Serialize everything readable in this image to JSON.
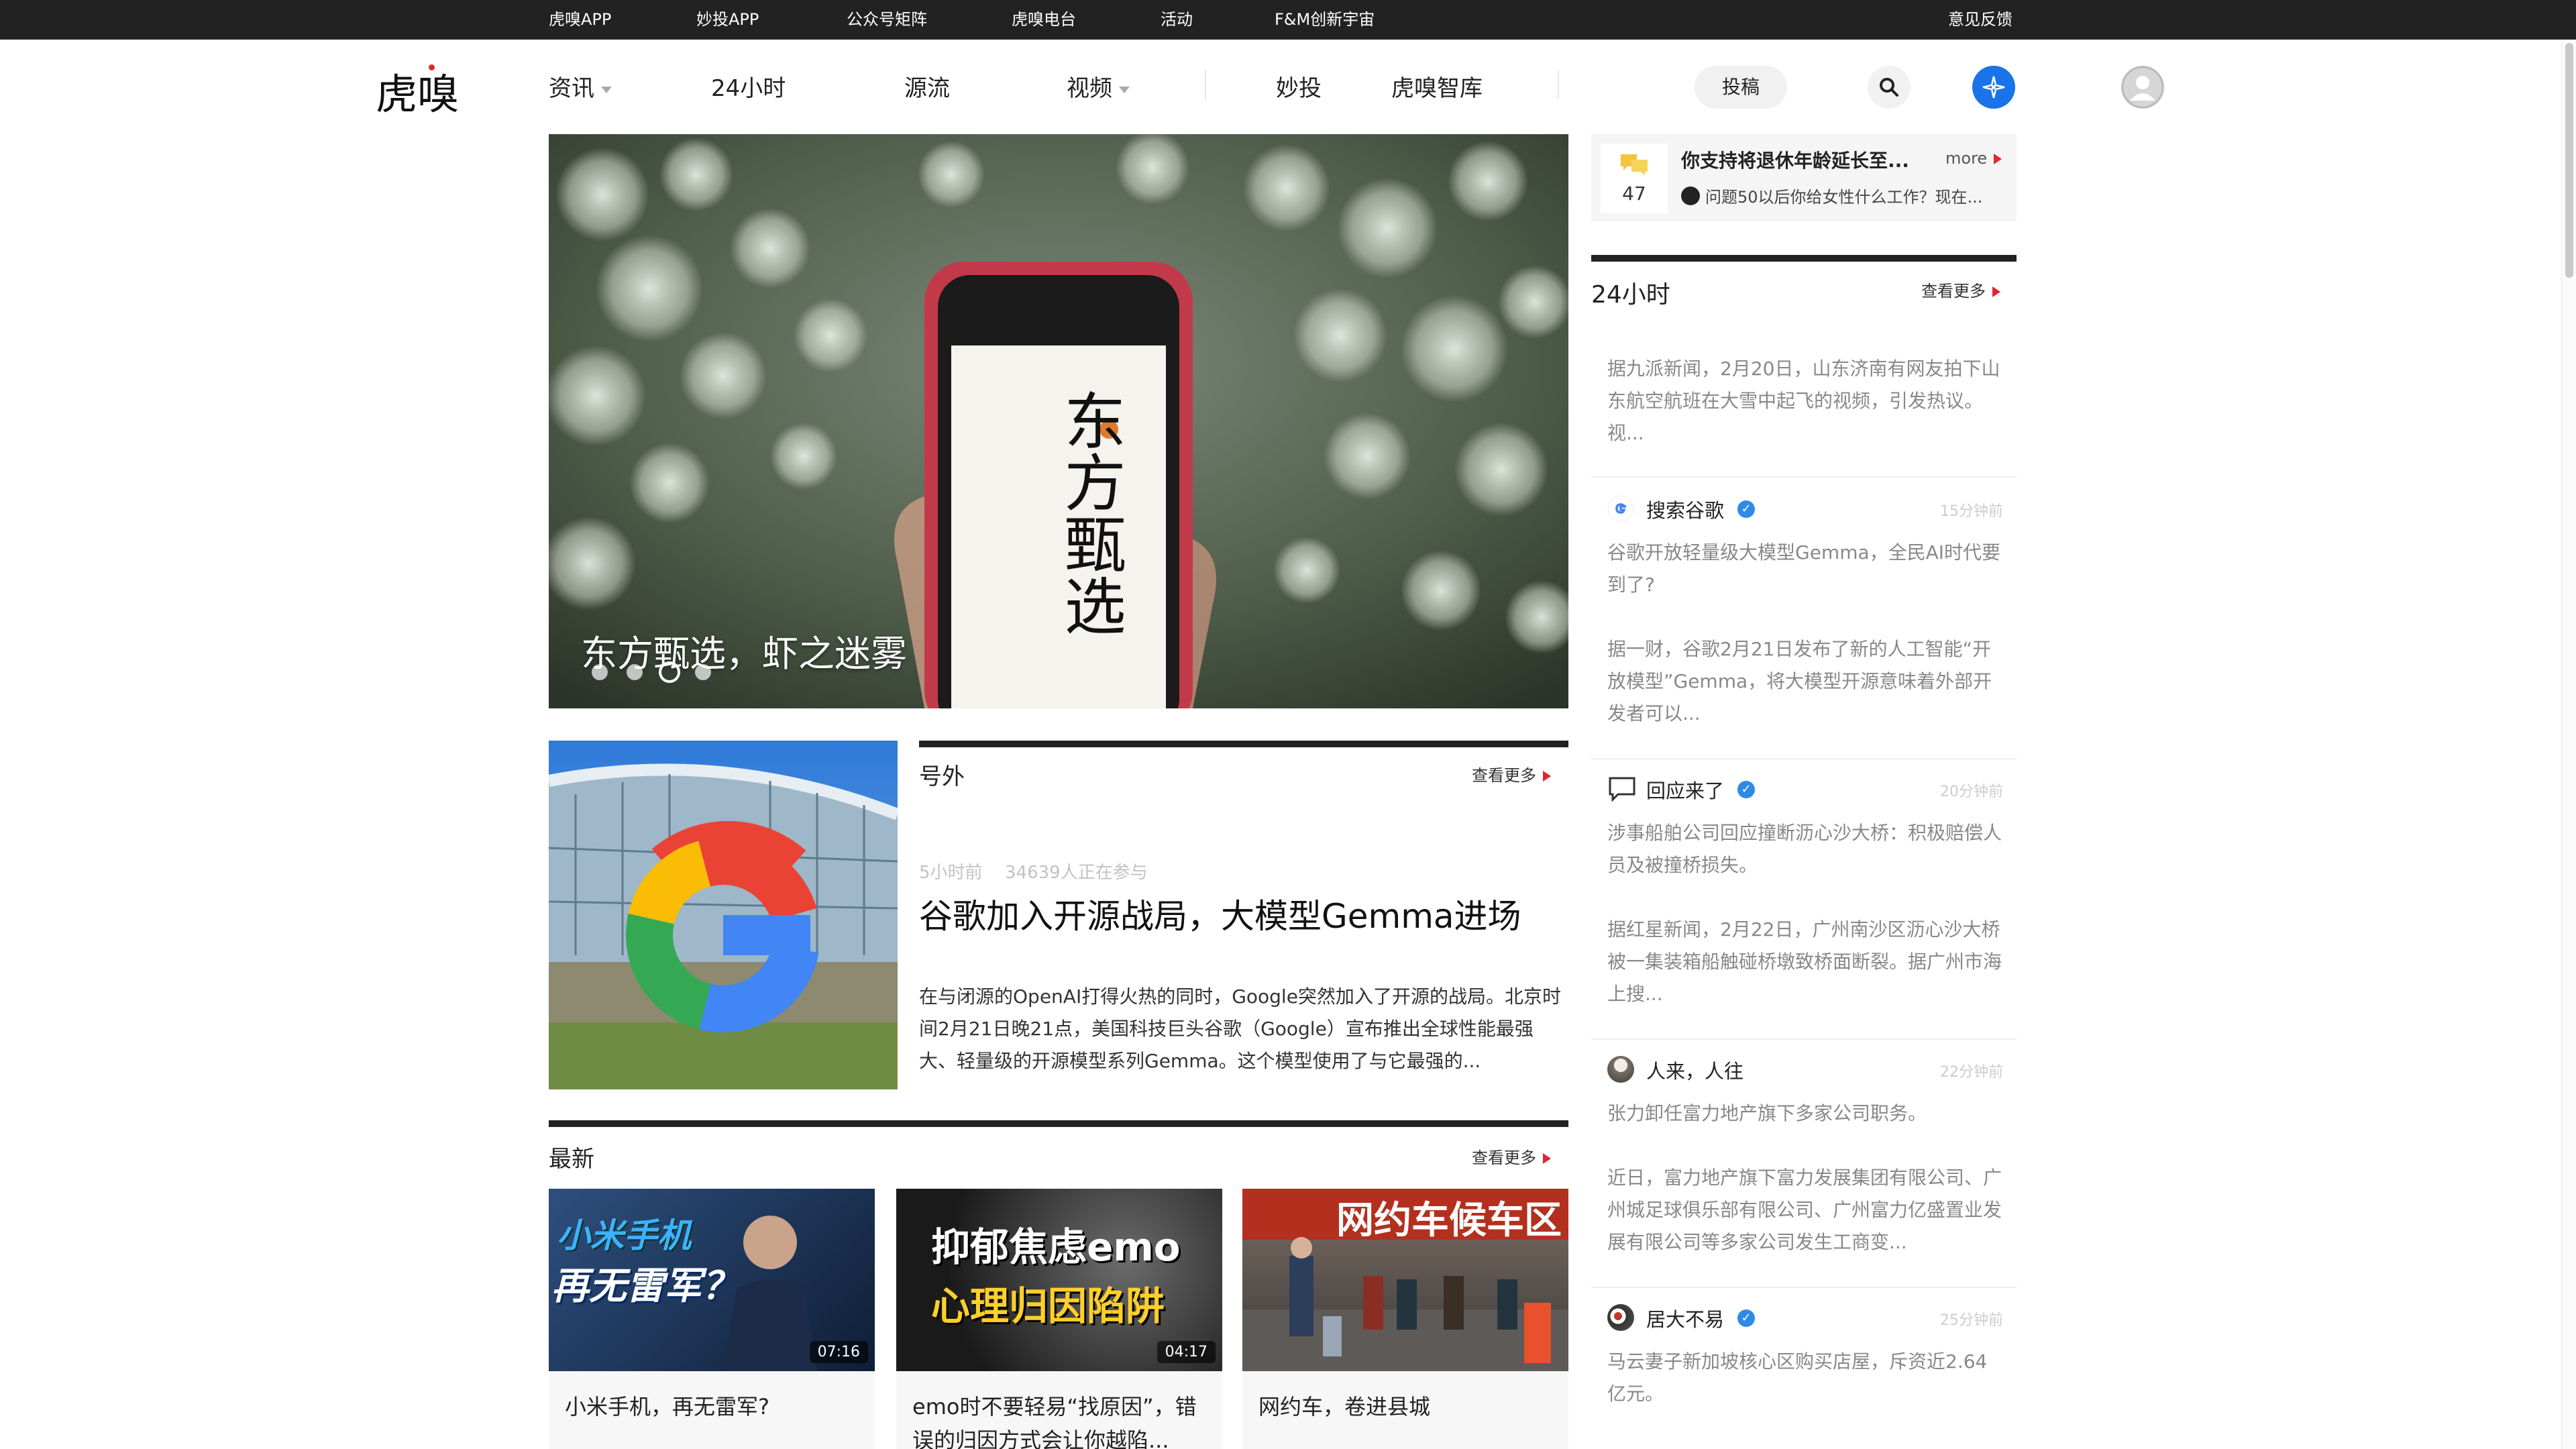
{
  "topbar": {
    "links": [
      "虎嗅APP",
      "妙投APP",
      "公众号矩阵",
      "虎嗅电台",
      "活动",
      "F&M创新宇宙"
    ],
    "feedback": "意见反馈"
  },
  "header": {
    "logo": "虎嗅",
    "nav": [
      "资讯",
      "24小时",
      "源流",
      "视频",
      "妙投",
      "虎嗅智库"
    ],
    "submit_label": "投稿"
  },
  "hero": {
    "title": "东方甄选，虾之迷雾",
    "phone_text": "东方甄选",
    "slides": 4,
    "active_slide": 3
  },
  "extra": {
    "section_title": "号外",
    "more": "查看更多",
    "time": "5小时前",
    "readers": "34639人正在参与",
    "headline": "谷歌加入开源战局，大模型Gemma进场",
    "summary": "在与闭源的OpenAI打得火热的同时，Google突然加入了开源的战局。北京时间2月21日晚21点，美国科技巨头谷歌（Google）宣布推出全球性能最强大、轻量级的开源模型系列Gemma。这个模型使用了与它最强的..."
  },
  "latest": {
    "section_title": "最新",
    "more": "查看更多",
    "cards": [
      {
        "overlay1": "小米手机",
        "overlay2": "再无雷军？",
        "duration": "07:16",
        "title": "小米手机，再无雷军?"
      },
      {
        "overlay1": "抑郁焦虑emo",
        "overlay2": "心理归因陷阱",
        "duration": "04:17",
        "title": "emo时不要轻易“找原因”，错误的归因方式会让你越陷..."
      },
      {
        "overlay1": "网约车候车区",
        "overlay2": "",
        "duration": "",
        "title": "网约车，卷进县城"
      }
    ]
  },
  "question": {
    "count": "47",
    "title": "你支持将退休年龄延长至...",
    "more": "more",
    "sub": "问题50以后你给女性什么工作？现在..."
  },
  "feed": {
    "title": "24小时",
    "more": "查看更多",
    "first_text": "据九派新闻，2月20日，山东济南有网友拍下山东航空航班在大雪中起飞的视频，引发热议。视...",
    "items": [
      {
        "name": "搜索谷歌",
        "time": "15分钟前",
        "headline": "谷歌开放轻量级大模型Gemma，全民AI时代要到了?",
        "body": "据一财，谷歌2月21日发布了新的人工智能“开放模型”Gemma，将大模型开源意味着外部开发者可以..."
      },
      {
        "name": "回应来了",
        "time": "20分钟前",
        "headline": "涉事船舶公司回应撞断沥心沙大桥：积极赔偿人员及被撞桥损失。",
        "body": "据红星新闻，2月22日，广州南沙区沥心沙大桥被一集装箱船触碰桥墩致桥面断裂。据广州市海上搜..."
      },
      {
        "name": "人来，人往",
        "time": "22分钟前",
        "headline": "张力卸任富力地产旗下多家公司职务。",
        "body": "近日，富力地产旗下富力发展集团有限公司、广州城足球俱乐部有限公司、广州富力亿盛置业发展有限公司等多家公司发生工商变..."
      },
      {
        "name": "居大不易",
        "time": "25分钟前",
        "headline": "马云妻子新加坡核心区购买店屋，斥资近2.64亿元。",
        "body": ""
      }
    ]
  },
  "colors": {
    "accent": "#e4252c",
    "topbar": "#222222",
    "link_blue": "#1a73e8"
  }
}
